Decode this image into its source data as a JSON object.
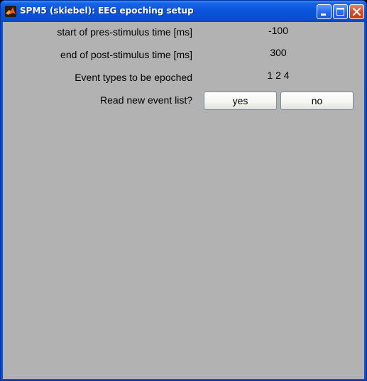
{
  "window": {
    "title": "SPM5 (skiebel): EEG epoching setup"
  },
  "form": {
    "rows": [
      {
        "label": "start of pres-stimulus time [ms]",
        "value": "-100"
      },
      {
        "label": "end of post-stimulus time [ms]",
        "value": "300"
      },
      {
        "label": "Event types to be epoched",
        "value": "1 2 4"
      }
    ],
    "question": {
      "label": "Read new event list?",
      "yes_label": "yes",
      "no_label": "no"
    }
  },
  "icons": {
    "app": "matlab-logo-icon",
    "minimize": "minimize-icon",
    "maximize": "maximize-icon",
    "close": "close-icon"
  },
  "colors": {
    "titlebar": "#0a55db",
    "client_background": "#b2b2b2",
    "close_button": "#d5502a"
  }
}
